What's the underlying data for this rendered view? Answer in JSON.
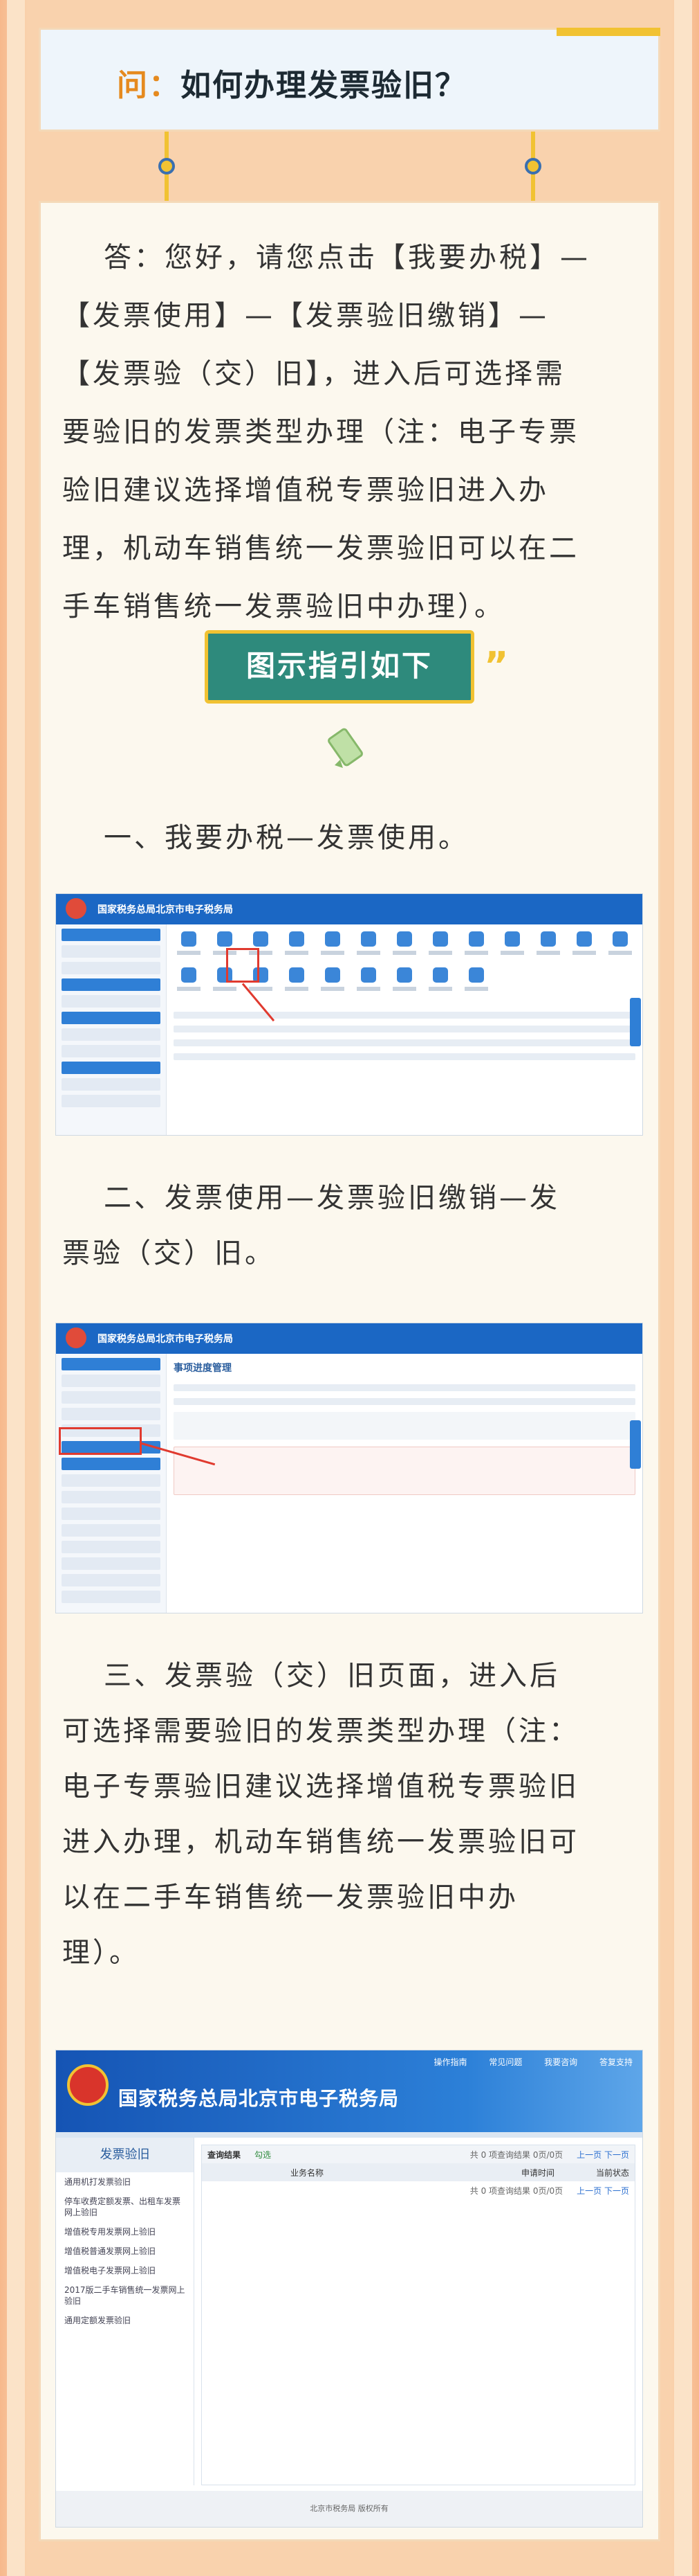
{
  "question": {
    "label": "问：",
    "text": "如何办理发票验旧？"
  },
  "answer": {
    "lines": [
      "答：您好，请您点击【我要办税】—",
      "【发票使用】—【发票验旧缴销】—",
      "【发票验（交）旧】，进入后可选择需",
      "要验旧的发票类型办理（注：电子专票",
      "验旧建议选择增值税专票验旧进入办",
      "理，机动车销售统一发票验旧可以在二",
      "手车销售统一发票验旧中办理）。"
    ]
  },
  "guide_button": "图示指引如下",
  "guide_quote": "”",
  "pencil_icon": "pencil-icon",
  "steps": [
    {
      "lines": [
        "一、我要办税—发票使用。"
      ]
    },
    {
      "lines": [
        "二、发票使用—发票验旧缴销—发",
        "票验（交）旧。"
      ]
    },
    {
      "lines": [
        "三、发票验（交）旧页面，进入后",
        "可选择需要验旧的发票类型办理（注：",
        "电子专票验旧建议选择增值税专票验旧",
        "进入办理，机动车销售统一发票验旧可",
        "以在二手车销售统一发票验旧中办",
        "理）。"
      ]
    }
  ],
  "screenshot1": {
    "title": "国家税务总局北京市电子税务局"
  },
  "screenshot2": {
    "title": "国家税务总局北京市电子税务局",
    "panel_title": "事项进度管理"
  },
  "screenshot3": {
    "title": "国家税务总局北京市电子税务局",
    "top_links": "操作指南 常见问题 我要咨询 答复支持",
    "side_title": "发票验旧",
    "side_items": [
      "通用机打发票验旧",
      "停车收费定额发票、出租车发票网上验旧",
      "增值税专用发票网上验旧",
      "增值税普通发票网上验旧",
      "增值税电子发票网上验旧",
      "2017版二手车销售统一发票网上验旧",
      "通用定额发票验旧"
    ],
    "result_label": "查询结果",
    "radio_label": "勾选",
    "pager_left": "共 0 项查询结果 0页/0页",
    "pager_right": "上一页 下一页",
    "col_business": "业务名称",
    "col_time": "申请时间",
    "col_status": "当前状态",
    "footer": "北京市税务局 版权所有"
  },
  "colors": {
    "accent_teal": "#2e8a7c",
    "accent_gold": "#f1c232",
    "label_orange": "#e58a1f"
  }
}
